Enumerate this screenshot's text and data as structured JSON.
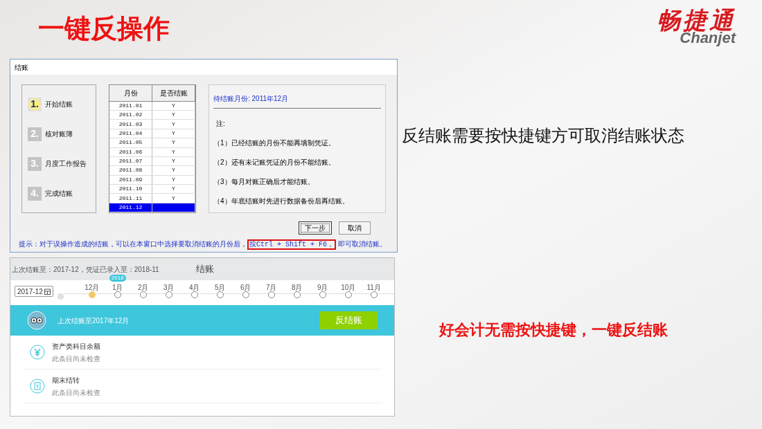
{
  "slide": {
    "title": "一键反操作",
    "logo": {
      "name": "畅捷通",
      "latin": "Chanjet"
    }
  },
  "dialog": {
    "title": "结账",
    "steps": [
      {
        "number": "1.",
        "label": "开始结账",
        "selected": true
      },
      {
        "number": "2.",
        "label": "核对账簿",
        "selected": false
      },
      {
        "number": "3.",
        "label": "月度工作报告",
        "selected": false
      },
      {
        "number": "4.",
        "label": "完成结账",
        "selected": false
      }
    ],
    "table": {
      "columns": [
        "月份",
        "是否结账"
      ],
      "rows": [
        {
          "cells": [
            "2011.01",
            "Y"
          ],
          "selected": false
        },
        {
          "cells": [
            "2011.02",
            "Y"
          ],
          "selected": false
        },
        {
          "cells": [
            "2011.03",
            "Y"
          ],
          "selected": false
        },
        {
          "cells": [
            "2011.04",
            "Y"
          ],
          "selected": false
        },
        {
          "cells": [
            "2011.05",
            "Y"
          ],
          "selected": false
        },
        {
          "cells": [
            "2011.06",
            "Y"
          ],
          "selected": false
        },
        {
          "cells": [
            "2011.07",
            "Y"
          ],
          "selected": false
        },
        {
          "cells": [
            "2011.08",
            "Y"
          ],
          "selected": false
        },
        {
          "cells": [
            "2011.09",
            "Y"
          ],
          "selected": false
        },
        {
          "cells": [
            "2011.10",
            "Y"
          ],
          "selected": false
        },
        {
          "cells": [
            "2011.11",
            "Y"
          ],
          "selected": false
        },
        {
          "cells": [
            "2011.12"
          ],
          "selected": true
        }
      ]
    },
    "info": {
      "pending": "待结账月份: 2011年12月",
      "note_label": "注:",
      "notes": [
        "（1）已经结账的月份不能再填制凭证。",
        "（2）还有未记账凭证的月份不能结账。",
        "（3）每月对账正确后才能结账。",
        "（4）年底结账时先进行数据备份后再结账。"
      ]
    },
    "buttons": [
      {
        "label": "下一步",
        "default": true
      },
      {
        "label": "取消",
        "default": false
      }
    ],
    "hint": {
      "before": "提示：对于误操作造成的结账，可以在本窗口中选择要取消结账的月份后，",
      "highlight": "按Ctrl + Shift + F6，",
      "after": "即可取消结账。"
    }
  },
  "app": {
    "status": "上次结账至：2017-12，凭证已录入至：2018-11",
    "title": "结账",
    "date_field": "2017-12",
    "months": [
      {
        "label": "12月",
        "selected": true
      },
      {
        "label": "1月",
        "selected": false,
        "badge": "2018"
      },
      {
        "label": "2月",
        "selected": false
      },
      {
        "label": "3月",
        "selected": false
      },
      {
        "label": "4月",
        "selected": false
      },
      {
        "label": "5月",
        "selected": false
      },
      {
        "label": "6月",
        "selected": false
      },
      {
        "label": "7月",
        "selected": false
      },
      {
        "label": "8月",
        "selected": false
      },
      {
        "label": "9月",
        "selected": false
      },
      {
        "label": "10月",
        "selected": false
      },
      {
        "label": "11月",
        "selected": false
      }
    ],
    "banner": {
      "text": "上次结账至2017年12月",
      "button": "反结账"
    },
    "checks": [
      {
        "kind": "currency",
        "title": "资产类科目余额",
        "status": "此条目尚未检查"
      },
      {
        "kind": "transfer",
        "title": "期末结转",
        "status": "此条目尚未检查"
      }
    ]
  },
  "captions": [
    {
      "kind": "note",
      "text": "反结账需要按快捷键方可取消结账状态"
    },
    {
      "kind": "highlight",
      "text": "好会计无需按快捷键，一键反结账"
    }
  ]
}
